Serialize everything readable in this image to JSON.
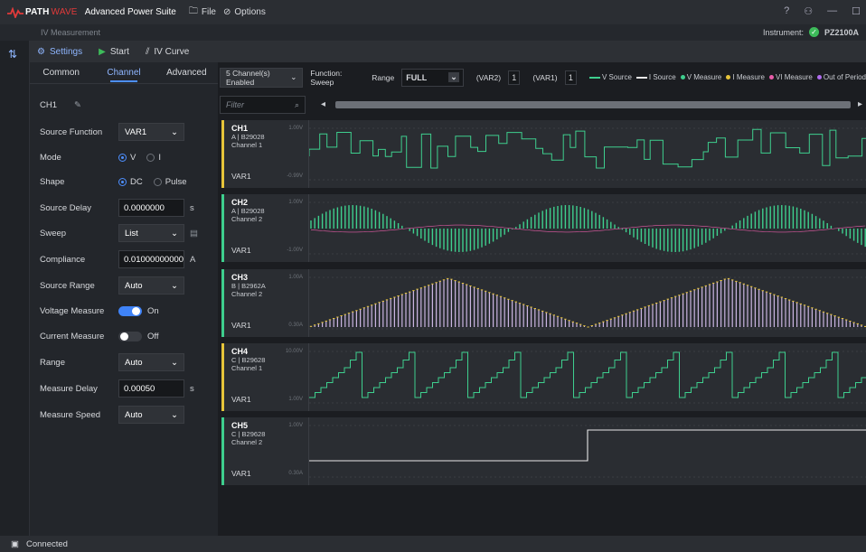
{
  "app": {
    "logo_part1": "PATH",
    "logo_part2": "WAVE",
    "title": "Advanced Power Suite",
    "menu_file": "File",
    "menu_options": "Options",
    "window_icons": [
      "help-icon",
      "user-icon",
      "minimize-icon",
      "maximize-icon",
      "close-icon"
    ]
  },
  "subheader": {
    "view_title": "IV Measurement",
    "instrument_label": "Instrument:",
    "instrument_name": "PZ2100A"
  },
  "toolbar": {
    "settings_label": "Settings",
    "start_label": "Start",
    "ivcurve_label": "IV Curve"
  },
  "left_panel": {
    "tabs": [
      "Common",
      "Channel",
      "Advanced"
    ],
    "active_tab": "Channel",
    "channel_name": "CH1",
    "source_function": {
      "label": "Source Function",
      "value": "VAR1"
    },
    "mode": {
      "label": "Mode",
      "opt1": "V",
      "opt2": "I",
      "selected": "V"
    },
    "shape": {
      "label": "Shape",
      "opt1": "DC",
      "opt2": "Pulse",
      "selected": "DC"
    },
    "source_delay": {
      "label": "Source Delay",
      "value": "0.0000000",
      "unit": "s"
    },
    "sweep": {
      "label": "Sweep",
      "value": "List"
    },
    "compliance": {
      "label": "Compliance",
      "value": "0.010000000000(",
      "unit": "A"
    },
    "source_range": {
      "label": "Source Range",
      "value": "Auto"
    },
    "voltage_measure": {
      "label": "Voltage Measure",
      "state": "On",
      "on": true
    },
    "current_measure": {
      "label": "Current Measure",
      "state": "Off",
      "on": false
    },
    "range": {
      "label": "Range",
      "value": "Auto"
    },
    "measure_delay": {
      "label": "Measure Delay",
      "value": "0.00050",
      "unit": "s"
    },
    "measure_speed": {
      "label": "Measure Speed",
      "value": "Auto"
    }
  },
  "controls": {
    "channels_enabled": "5 Channel(s) Enabled",
    "function": "Function: Sweep",
    "range_label": "Range",
    "range_value": "FULL",
    "var2_label": "(VAR2)",
    "var2_value": "1",
    "var1_label": "(VAR1)",
    "var1_value": "1",
    "filter_placeholder": "Filter",
    "legend": [
      {
        "label": "V Source",
        "color": "#3ecf8e",
        "kind": "line"
      },
      {
        "label": "I Source",
        "color": "#e8e8e8",
        "kind": "line"
      },
      {
        "label": "V Measure",
        "color": "#3ecf8e",
        "kind": "dot"
      },
      {
        "label": "I Measure",
        "color": "#e6c43a",
        "kind": "dot"
      },
      {
        "label": "VI Measure",
        "color": "#e85ca8",
        "kind": "dot"
      },
      {
        "label": "Out of Period",
        "color": "#b06cf0",
        "kind": "dot"
      }
    ]
  },
  "channels": [
    {
      "name": "CH1",
      "unit": "A | B29028",
      "sub": "Channel 1",
      "var": "VAR1",
      "ytop": "1.00V",
      "ybot": "-0.99V",
      "color": "#e6c43a"
    },
    {
      "name": "CH2",
      "unit": "A | B29028",
      "sub": "Channel 2",
      "var": "VAR1",
      "ytop": "1.00V",
      "ybot": "-1.00V",
      "color": "#3ecf8e"
    },
    {
      "name": "CH3",
      "unit": "B | B2962A",
      "sub": "Channel 2",
      "var": "VAR1",
      "ytop": "1.00A",
      "ybot": "0.30A",
      "color": "#3ecf8e"
    },
    {
      "name": "CH4",
      "unit": "C | B29628",
      "sub": "Channel 1",
      "var": "VAR1",
      "ytop": "10.00V",
      "ybot": "1.00V",
      "color": "#e6c43a"
    },
    {
      "name": "CH5",
      "unit": "C | B29628",
      "sub": "Channel 2",
      "var": "VAR1",
      "ytop": "1.00V",
      "ybot": "0.30A",
      "color": "#3ecf8e"
    }
  ],
  "status": {
    "text": "Connected"
  }
}
